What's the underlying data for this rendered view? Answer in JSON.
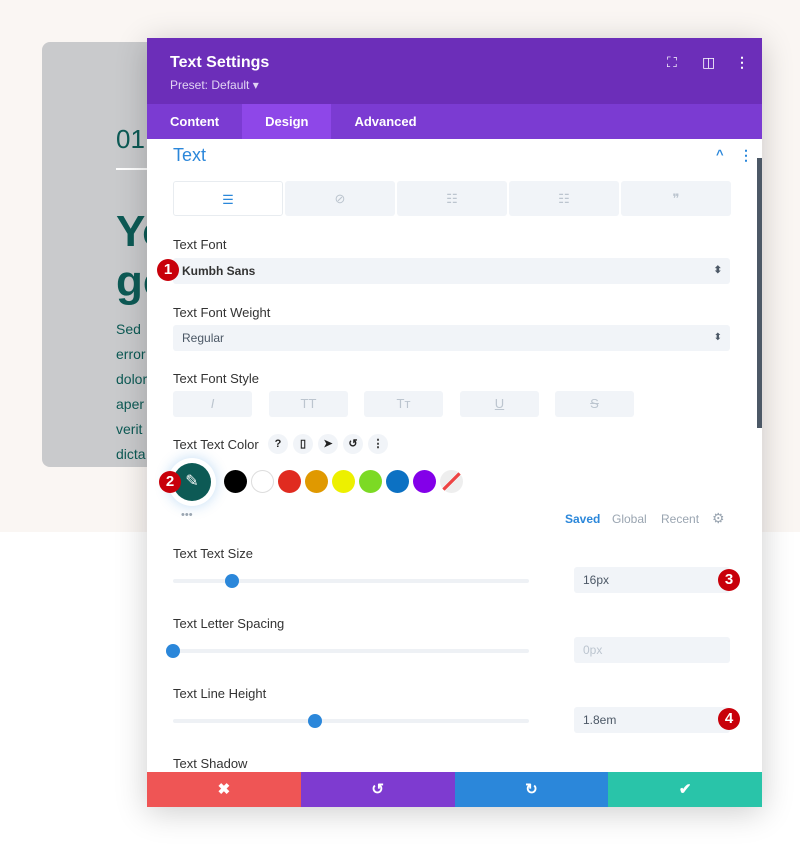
{
  "background": {
    "number": "01",
    "heading_lines": [
      "Yo",
      "go"
    ],
    "body_lines": [
      "Sed",
      "error",
      "dolor",
      "aper",
      "verit",
      "dicta"
    ]
  },
  "modal": {
    "title": "Text Settings",
    "preset": "Preset: Default ▾",
    "header_icons": [
      "fullscreen-icon",
      "split-view-icon",
      "more-icon"
    ],
    "tabs": [
      {
        "label": "Content"
      },
      {
        "label": "Design",
        "active": true
      },
      {
        "label": "Advanced"
      }
    ],
    "section_title": "Text",
    "subtabs": [
      "align-left-icon",
      "link-icon",
      "unordered-list-icon",
      "ordered-list-icon",
      "quote-icon"
    ],
    "text_font": {
      "label": "Text Font",
      "value": "Kumbh Sans"
    },
    "font_weight": {
      "label": "Text Font Weight",
      "value": "Regular"
    },
    "font_style": {
      "label": "Text Font Style",
      "buttons": [
        "I",
        "TT",
        "Tт",
        "U",
        "S"
      ]
    },
    "text_color": {
      "label": "Text Text Color",
      "mini_icons": [
        "?",
        "▯",
        "➤",
        "↺",
        "⋮"
      ],
      "selected": "#0d5a55",
      "swatches": [
        "#000000",
        "#ffffff",
        "#e02b20",
        "#e09900",
        "#edf000",
        "#7cda24",
        "#0c71c3",
        "#8300e9"
      ],
      "palette_tabs": [
        "Saved",
        "Global",
        "Recent"
      ],
      "more": "•••"
    },
    "text_size": {
      "label": "Text Text Size",
      "value": "16px",
      "slider_percent": 16.6
    },
    "letter_spacing": {
      "label": "Text Letter Spacing",
      "value": "0px",
      "slider_percent": 0
    },
    "line_height": {
      "label": "Text Line Height",
      "value": "1.8em",
      "slider_percent": 40
    },
    "text_shadow": {
      "label": "Text Shadow"
    },
    "badges": [
      "1",
      "2",
      "3",
      "4"
    ],
    "footer": [
      {
        "icon": "✖",
        "color": "#ef5555"
      },
      {
        "icon": "↺",
        "color": "#7e3bd0"
      },
      {
        "icon": "↻",
        "color": "#2b87da"
      },
      {
        "icon": "✔",
        "color": "#29c4a9"
      }
    ]
  }
}
